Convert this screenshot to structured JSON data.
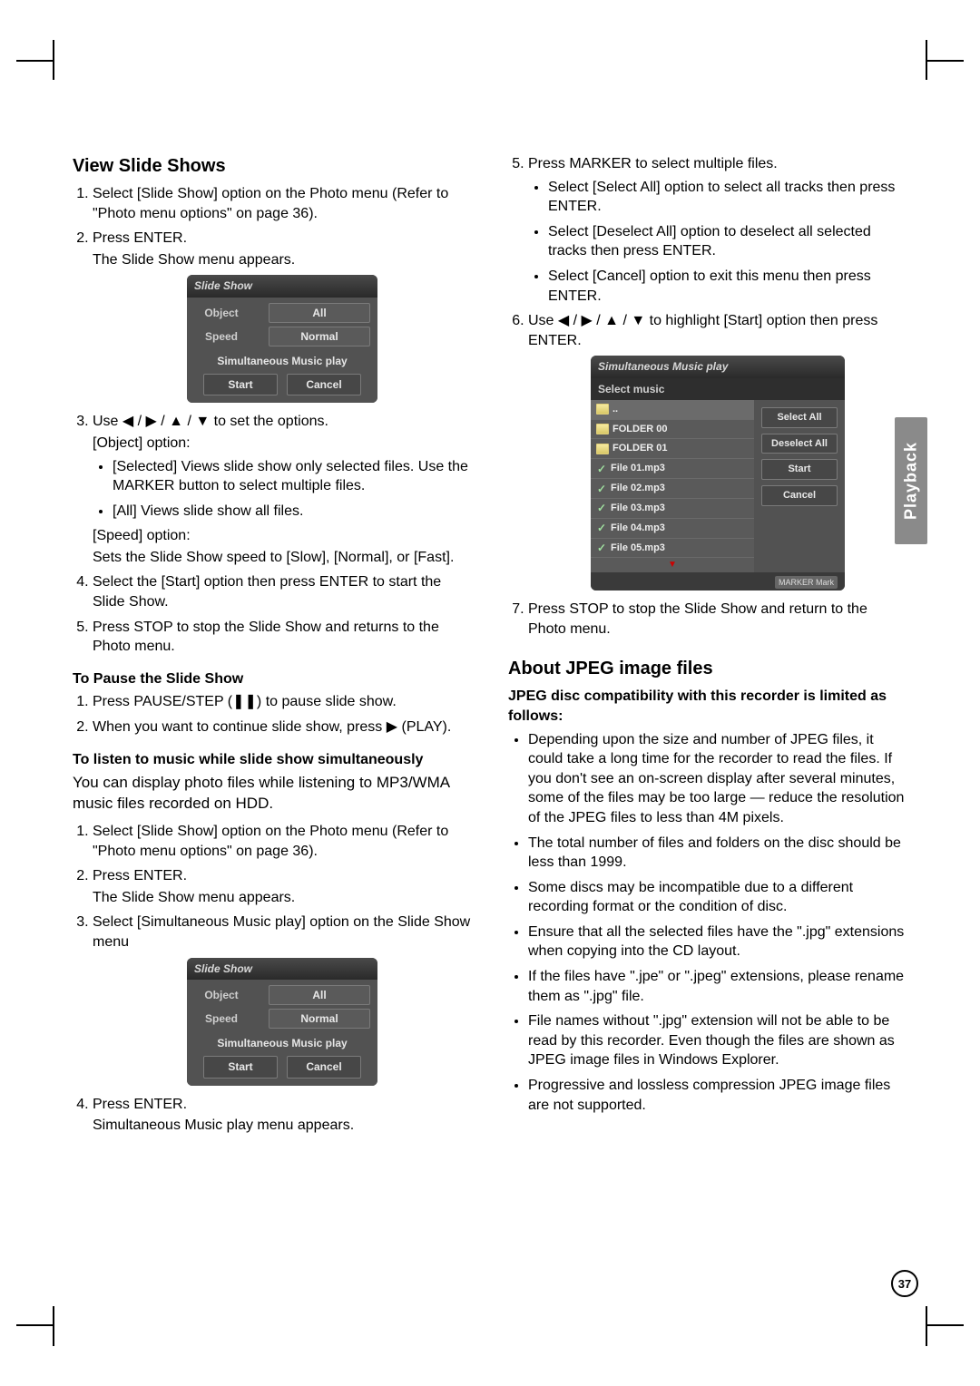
{
  "page_number": "37",
  "side_tab": "Playback",
  "left": {
    "heading": "View Slide Shows",
    "steps_a": [
      "Select [Slide Show] option on the Photo menu (Refer to \"Photo menu options\" on page 36).",
      "Press ENTER.",
      "Use ◀ / ▶ / ▲ / ▼ to set the options.",
      "Select the [Start] option then press ENTER to start the Slide Show.",
      "Press STOP to stop the Slide Show and returns to the Photo menu."
    ],
    "step2_sub": "The Slide Show menu appears.",
    "step3_obj_label": "[Object] option:",
    "step3_obj_bullets": [
      "[Selected] Views slide show only selected files. Use the MARKER button to select multiple files.",
      "[All] Views slide show all files."
    ],
    "step3_speed_label": "[Speed] option:",
    "step3_speed_text": "Sets the Slide Show speed to [Slow], [Normal], or [Fast].",
    "pause_heading": "To Pause the Slide Show",
    "pause_steps": [
      "Press PAUSE/STEP (❚❚) to pause slide show.",
      "When you want to continue slide show, press ▶ (PLAY)."
    ],
    "music_heading": "To listen to music while slide show simultaneously",
    "music_intro": "You can display photo files while listening to MP3/WMA music files recorded on HDD.",
    "music_steps": [
      "Select [Slide Show] option on the Photo menu (Refer to \"Photo menu options\" on page 36).",
      "Press ENTER.",
      "Select [Simultaneous Music play] option on the Slide Show menu",
      "Press ENTER."
    ],
    "music_step2_sub": "The Slide Show menu appears.",
    "music_step4_sub": "Simultaneous Music play menu appears."
  },
  "right": {
    "steps": [
      "Press MARKER to select multiple files.",
      "Use ◀ / ▶ / ▲ / ▼ to highlight [Start] option then press ENTER.",
      "Press STOP to stop the Slide Show and return to the Photo menu."
    ],
    "step5_bullets": [
      "Select [Select All] option to select all tracks then press ENTER.",
      "Select [Deselect All] option to deselect all selected tracks then press ENTER.",
      "Select [Cancel] option to exit this menu then press ENTER."
    ],
    "jpeg_heading": "About JPEG image files",
    "jpeg_subheading": "JPEG disc compatibility with this recorder is limited as follows:",
    "jpeg_bullets": [
      "Depending upon the size and number of JPEG files, it could take a long time for the recorder to read the files. If you don't see an on-screen display after several minutes, some of the files may be too large — reduce the resolution of the JPEG files to less than 4M pixels.",
      "The total number of files and folders on the disc should be less than 1999.",
      "Some discs may be incompatible due to a different recording format or the condition of disc.",
      "Ensure that all the selected files have the \".jpg\" extensions when copying into the CD layout.",
      "If the files have \".jpe\" or \".jpeg\" extensions, please rename them as \".jpg\" file.",
      "File names without \".jpg\" extension will not be able to be read by this recorder. Even though the files are shown as JPEG image files in Windows Explorer.",
      "Progressive and lossless compression JPEG image files are not supported."
    ]
  },
  "dlgSlide": {
    "title": "Slide Show",
    "object_label": "Object",
    "object_value": "All",
    "speed_label": "Speed",
    "speed_value": "Normal",
    "sim_label": "Simultaneous Music play",
    "start": "Start",
    "cancel": "Cancel"
  },
  "dlgMusic": {
    "title": "Simultaneous Music play",
    "subtitle": "Select music",
    "items": [
      {
        "type": "back",
        "label": ".."
      },
      {
        "type": "folder",
        "label": "FOLDER 00"
      },
      {
        "type": "folder",
        "label": "FOLDER 01"
      },
      {
        "type": "file",
        "label": "File 01.mp3"
      },
      {
        "type": "file",
        "label": "File 02.mp3"
      },
      {
        "type": "file",
        "label": "File 03.mp3"
      },
      {
        "type": "file",
        "label": "File 04.mp3"
      },
      {
        "type": "file",
        "label": "File 05.mp3"
      }
    ],
    "side_buttons": [
      "Select All",
      "Deselect All",
      "Start",
      "Cancel"
    ],
    "marker_hint": "MARKER Mark"
  }
}
